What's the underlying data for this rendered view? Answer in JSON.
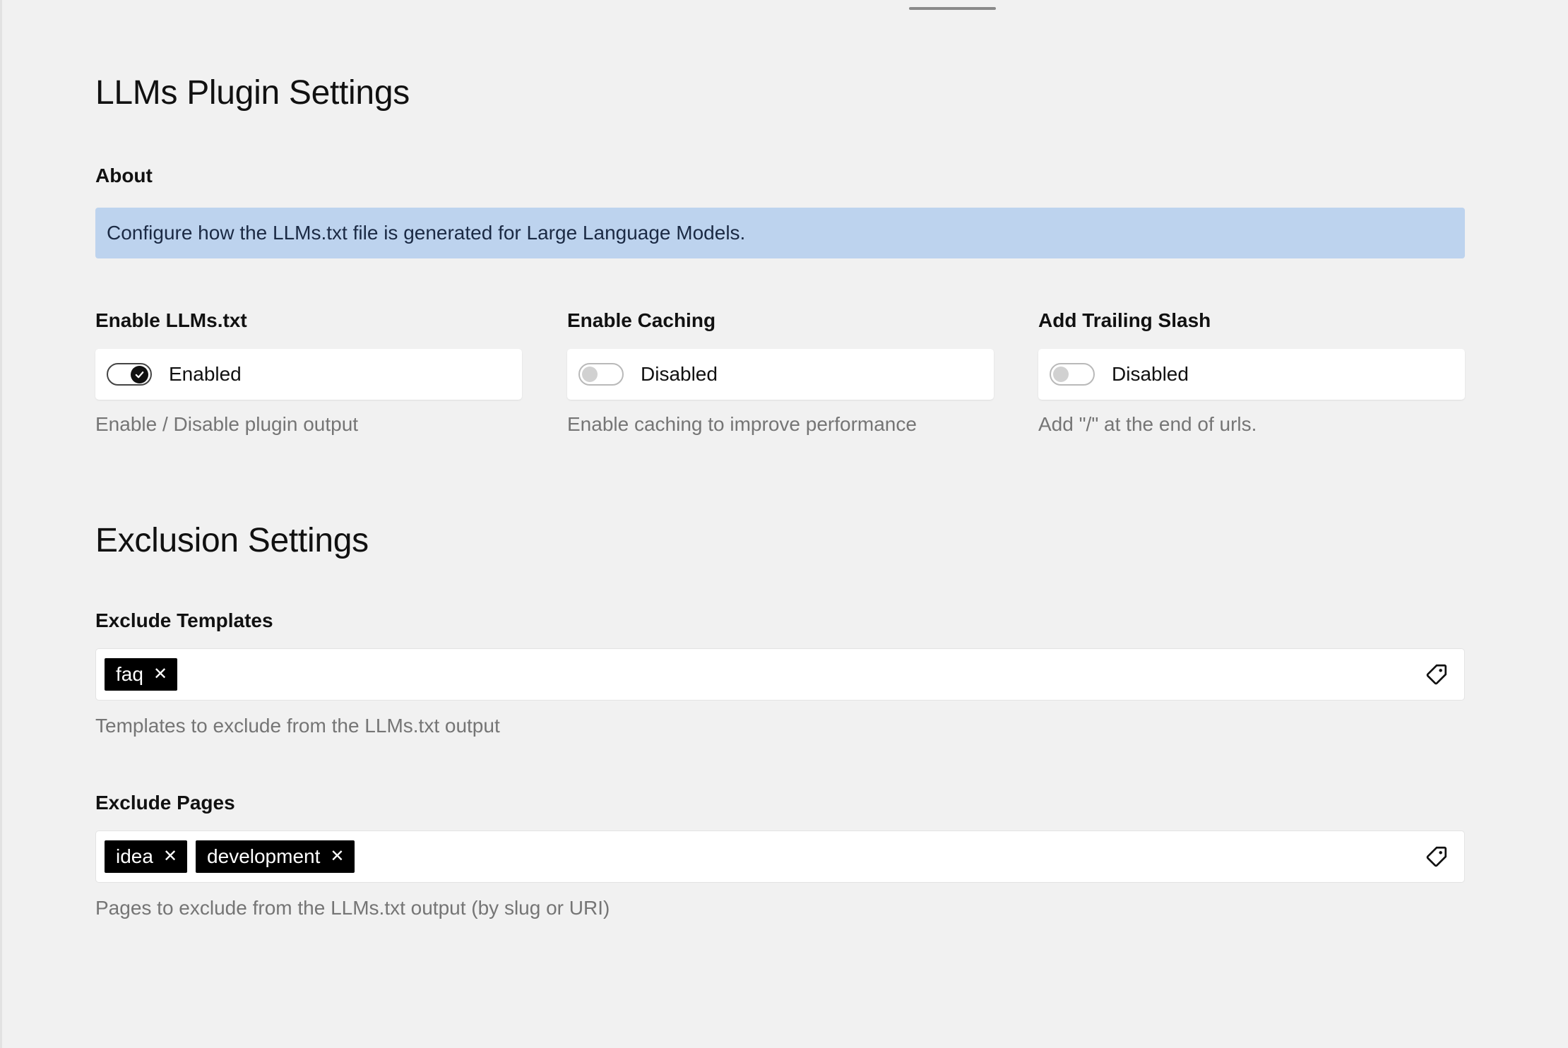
{
  "page": {
    "title": "LLMs Plugin Settings"
  },
  "about": {
    "label": "About",
    "notice": "Configure how the LLMs.txt file is generated for Large Language Models."
  },
  "toggles": [
    {
      "label": "Enable LLMs.txt",
      "state": "Enabled",
      "on": true,
      "help": "Enable / Disable plugin output"
    },
    {
      "label": "Enable Caching",
      "state": "Disabled",
      "on": false,
      "help": "Enable caching to improve performance"
    },
    {
      "label": "Add Trailing Slash",
      "state": "Disabled",
      "on": false,
      "help": "Add \"/\" at the end of urls."
    }
  ],
  "exclusion": {
    "title": "Exclusion Settings",
    "templates": {
      "label": "Exclude Templates",
      "tags": [
        "faq"
      ],
      "help": "Templates to exclude from the LLMs.txt output"
    },
    "pages": {
      "label": "Exclude Pages",
      "tags": [
        "idea",
        "development"
      ],
      "help": "Pages to exclude from the LLMs.txt output (by slug or URI)"
    }
  },
  "icons": {
    "tag": "tag-icon",
    "remove": "close-icon",
    "check": "check-icon"
  },
  "colors": {
    "notice_bg": "#bdd3ee",
    "tag_bg": "#000000",
    "background": "#f1f1f1"
  }
}
